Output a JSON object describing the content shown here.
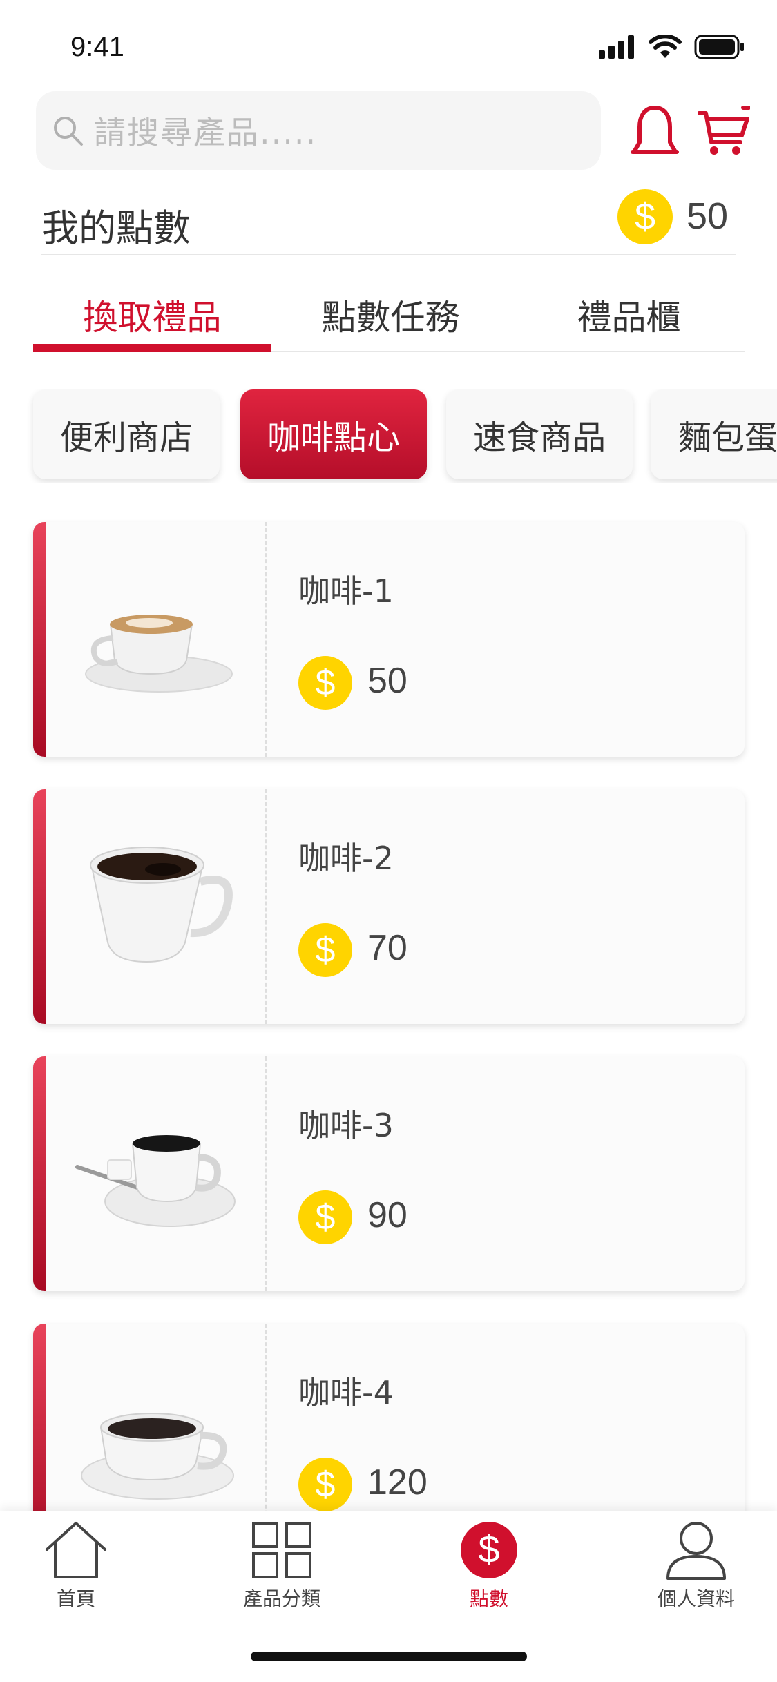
{
  "status_bar": {
    "time": "9:41"
  },
  "search": {
    "placeholder": "請搜尋產品....."
  },
  "points": {
    "label": "我的點數",
    "value": "50"
  },
  "tabs": [
    {
      "label": "換取禮品",
      "active": true
    },
    {
      "label": "點數任務",
      "active": false
    },
    {
      "label": "禮品櫃",
      "active": false
    }
  ],
  "categories": [
    {
      "label": "便利商店",
      "active": false
    },
    {
      "label": "咖啡點心",
      "active": true
    },
    {
      "label": "速食商品",
      "active": false
    },
    {
      "label": "麵包蛋",
      "active": false
    }
  ],
  "products": [
    {
      "name": "咖啡-1",
      "price": "50",
      "icon": "cappuccino-cup-image"
    },
    {
      "name": "咖啡-2",
      "price": "70",
      "icon": "black-coffee-cup-image"
    },
    {
      "name": "咖啡-3",
      "price": "90",
      "icon": "espresso-cup-with-spoon-image"
    },
    {
      "name": "咖啡-4",
      "price": "120",
      "icon": "coffee-cup-saucer-image"
    }
  ],
  "nav": [
    {
      "label": "首頁",
      "icon": "home-icon",
      "active": false
    },
    {
      "label": "產品分類",
      "icon": "grid-icon",
      "active": false
    },
    {
      "label": "點數",
      "icon": "points-icon",
      "active": true
    },
    {
      "label": "個人資料",
      "icon": "person-icon",
      "active": false
    }
  ],
  "colors": {
    "accent": "#d0102d",
    "coin": "#ffd400"
  }
}
